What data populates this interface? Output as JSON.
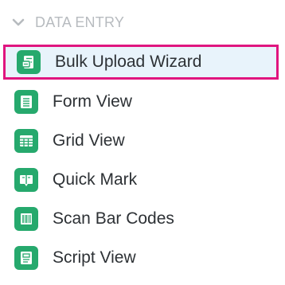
{
  "section": {
    "title": "DATA ENTRY",
    "chevron_icon": "chevron-down-icon",
    "title_color": "#b7bbbf"
  },
  "menu": {
    "selected_index": 0,
    "accent_color": "#26a96d",
    "highlight_border_color": "#e0157f",
    "highlight_background": "#e8f3fb",
    "items": [
      {
        "label": "Bulk Upload Wizard",
        "icon": "bulk-upload-icon"
      },
      {
        "label": "Form View",
        "icon": "form-view-icon"
      },
      {
        "label": "Grid View",
        "icon": "grid-view-icon"
      },
      {
        "label": "Quick Mark",
        "icon": "quick-mark-icon"
      },
      {
        "label": "Scan Bar Codes",
        "icon": "barcode-icon"
      },
      {
        "label": "Script View",
        "icon": "script-view-icon"
      }
    ]
  }
}
